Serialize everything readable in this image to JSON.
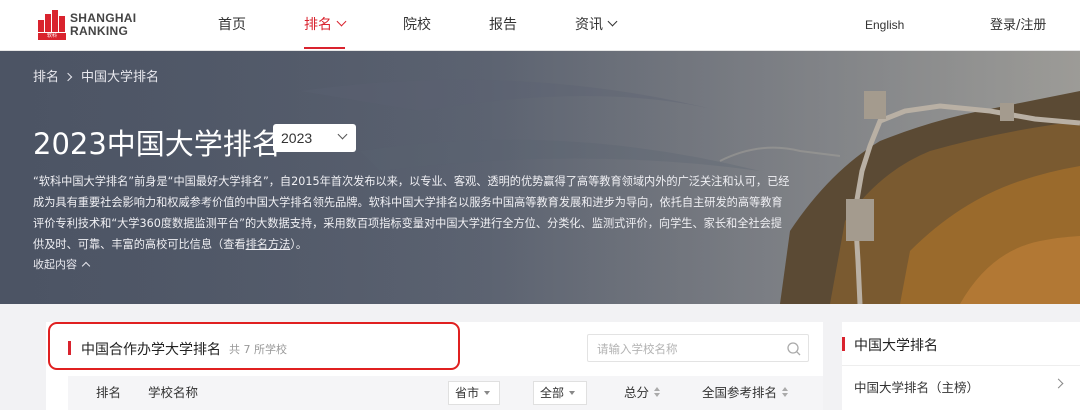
{
  "header": {
    "logo_line1": "SHANGHAI",
    "logo_line2": "RANKING",
    "logo_badge": "软科",
    "nav": [
      {
        "label": "首页",
        "active": false
      },
      {
        "label": "排名",
        "active": true
      },
      {
        "label": "院校",
        "active": false
      },
      {
        "label": "报告",
        "active": false
      },
      {
        "label": "资讯",
        "active": false
      }
    ],
    "english": "English",
    "login": "登录/注册"
  },
  "banner": {
    "breadcrumb": [
      "排名",
      "中国大学排名"
    ],
    "title": "2023中国大学排名",
    "year_selected": "2023",
    "description_before_link": "“软科中国大学排名”前身是“中国最好大学排名”，自2015年首次发布以来，以专业、客观、透明的优势赢得了高等教育领域内外的广泛关注和认可，已经成为具有重要社会影响力和权威参考价值的中国大学排名领先品牌。软科中国大学排名以服务中国高等教育发展和进步为导向，依托自主研发的高等教育评价专利技术和“大学360度数据监测平台”的大数据支持，采用数百项指标变量对中国大学进行全方位、分类化、监测式评价，向学生、家长和全社会提供及时、可靠、丰富的高校可比信息（查看",
    "description_link": "排名方法",
    "description_after_link": "）。",
    "collapse": "收起内容"
  },
  "main": {
    "title": "中国合作办学大学排名",
    "count": "共 7 所学校",
    "search_placeholder": "请输入学校名称",
    "columns": {
      "rank": "排名",
      "name": "学校名称",
      "province": "省市",
      "type": "全部",
      "score": "总分",
      "reference_rank": "全国参考排名"
    }
  },
  "side": {
    "title": "中国大学排名",
    "link": "中国大学排名（主榜）"
  },
  "colors": {
    "accent": "#d9232e",
    "highlight_box": "#e02020"
  }
}
